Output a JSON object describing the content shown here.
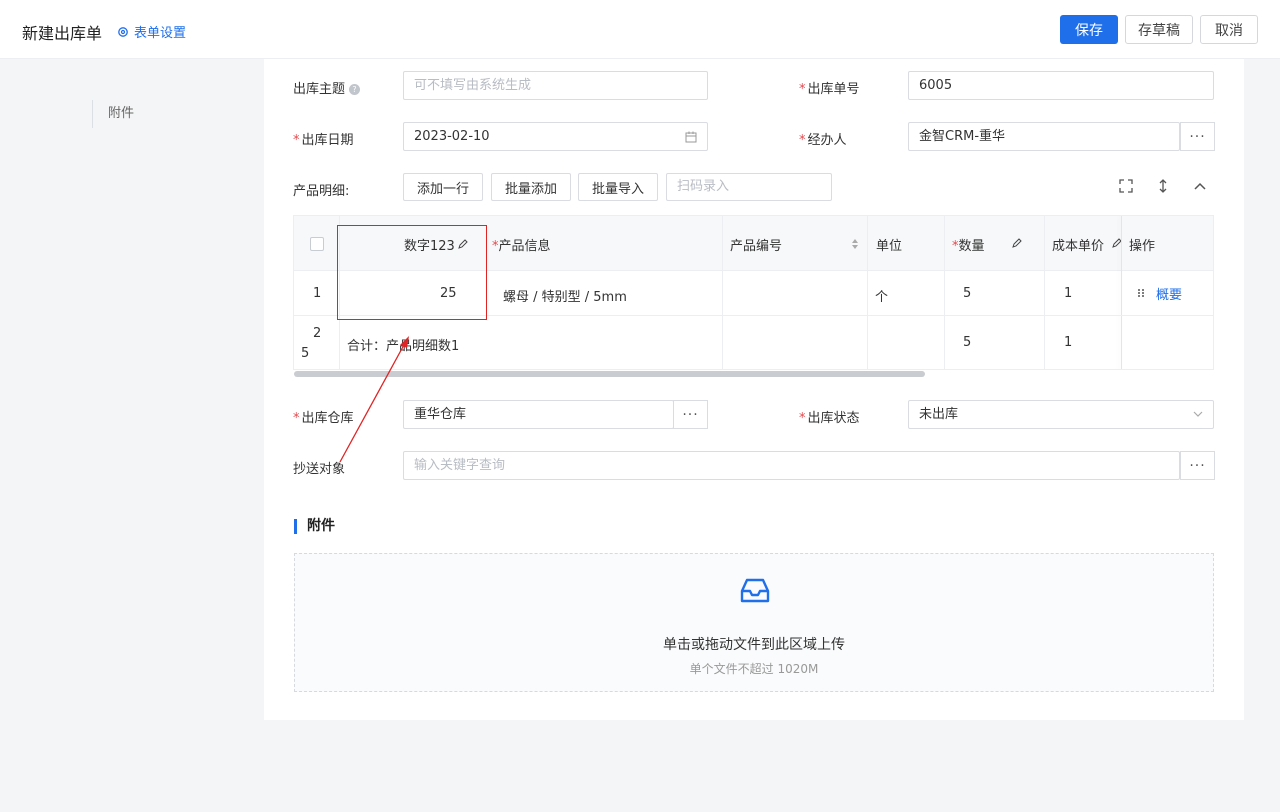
{
  "topbar": {
    "title": "新建出库单",
    "settings": "表单设置",
    "save": "保存",
    "draft": "存草稿",
    "cancel": "取消"
  },
  "sidebar": {
    "item": "附件"
  },
  "form": {
    "subject_label": "出库主题",
    "subject_placeholder": "可不填写由系统生成",
    "number_label": "出库单号",
    "number_value": "6005",
    "date_label": "出库日期",
    "date_value": "2023-02-10",
    "handler_label": "经办人",
    "handler_value": "金智CRM-重华",
    "products_label": "产品明细:",
    "add_row": "添加一行",
    "batch_add": "批量添加",
    "batch_import": "批量导入",
    "scan_placeholder": "扫码录入",
    "warehouse_label": "出库仓库",
    "warehouse_value": "重华仓库",
    "status_label": "出库状态",
    "status_value": "未出库",
    "cc_label": "抄送对象",
    "cc_placeholder": "输入关键字查询"
  },
  "table": {
    "headers": {
      "num": "数字123",
      "product": "产品信息",
      "code": "产品编号",
      "unit": "单位",
      "qty": "数量",
      "cost": "成本单价",
      "ops": "操作"
    },
    "row": {
      "index": "1",
      "num": "25",
      "product": "螺母 / 特别型 / 5mm",
      "unit": "个",
      "qty": "5",
      "cost": "1",
      "op": "概要"
    },
    "total": {
      "index_top": "2",
      "index_bottom": "5",
      "label": "合计：产品明细数1",
      "qty": "5",
      "cost": "1"
    }
  },
  "attachments": {
    "title": "附件",
    "upload_text": "单击或拖动文件到此区域上传",
    "upload_hint": "单个文件不超过 1020M"
  },
  "colors": {
    "accent": "#1f6feb",
    "required": "#e5484d",
    "annotation": "#e02424"
  }
}
